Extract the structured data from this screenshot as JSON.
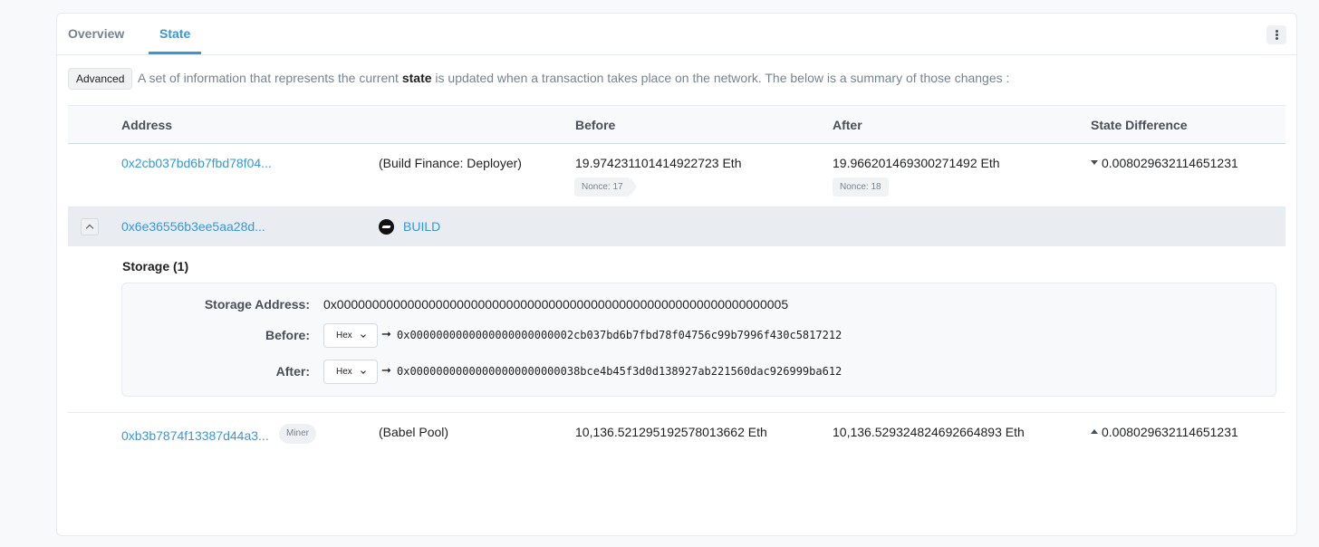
{
  "tabs": {
    "overview": "Overview",
    "state": "State"
  },
  "intro": {
    "badge": "Advanced",
    "text_before": "A set of information that represents the current",
    "text_bold": "state",
    "text_after": "is updated when a transaction takes place on the network. The below is a summary of those changes :"
  },
  "columns": {
    "address": "Address",
    "before": "Before",
    "after": "After",
    "diff": "State Difference"
  },
  "rows": [
    {
      "address": "0x2cb037bd6b7fbd78f04...",
      "name": "(Build Finance: Deployer)",
      "before": "19.974231101414922723 Eth",
      "before_nonce": "Nonce: 17",
      "after": "19.966201469300271492 Eth",
      "after_nonce": "Nonce: 18",
      "diff": "0.008029632114651231",
      "diff_direction": "down"
    },
    {
      "address": "0x6e36556b3ee5aa28d...",
      "token_label": "BUILD",
      "token_icon": "build-token-icon"
    },
    {
      "address": "0xb3b7874f13387d44a3...",
      "badge": "Miner",
      "name": "(Babel Pool)",
      "before": "10,136.521295192578013662 Eth",
      "after": "10,136.529324824692664893 Eth",
      "diff": "0.008029632114651231",
      "diff_direction": "up"
    }
  ],
  "storage": {
    "title": "Storage (1)",
    "address_label": "Storage Address:",
    "address_value": "0x0000000000000000000000000000000000000000000000000000000000000005",
    "before_label": "Before:",
    "before_format": "Hex",
    "before_value": "0x0000000000000000000000002cb037bd6b7fbd78f04756c99b7996f430c5817212",
    "after_label": "After:",
    "after_format": "Hex",
    "after_value": "0x00000000000000000000000038bce4b45f3d0d138927ab221560dac926999ba612"
  }
}
